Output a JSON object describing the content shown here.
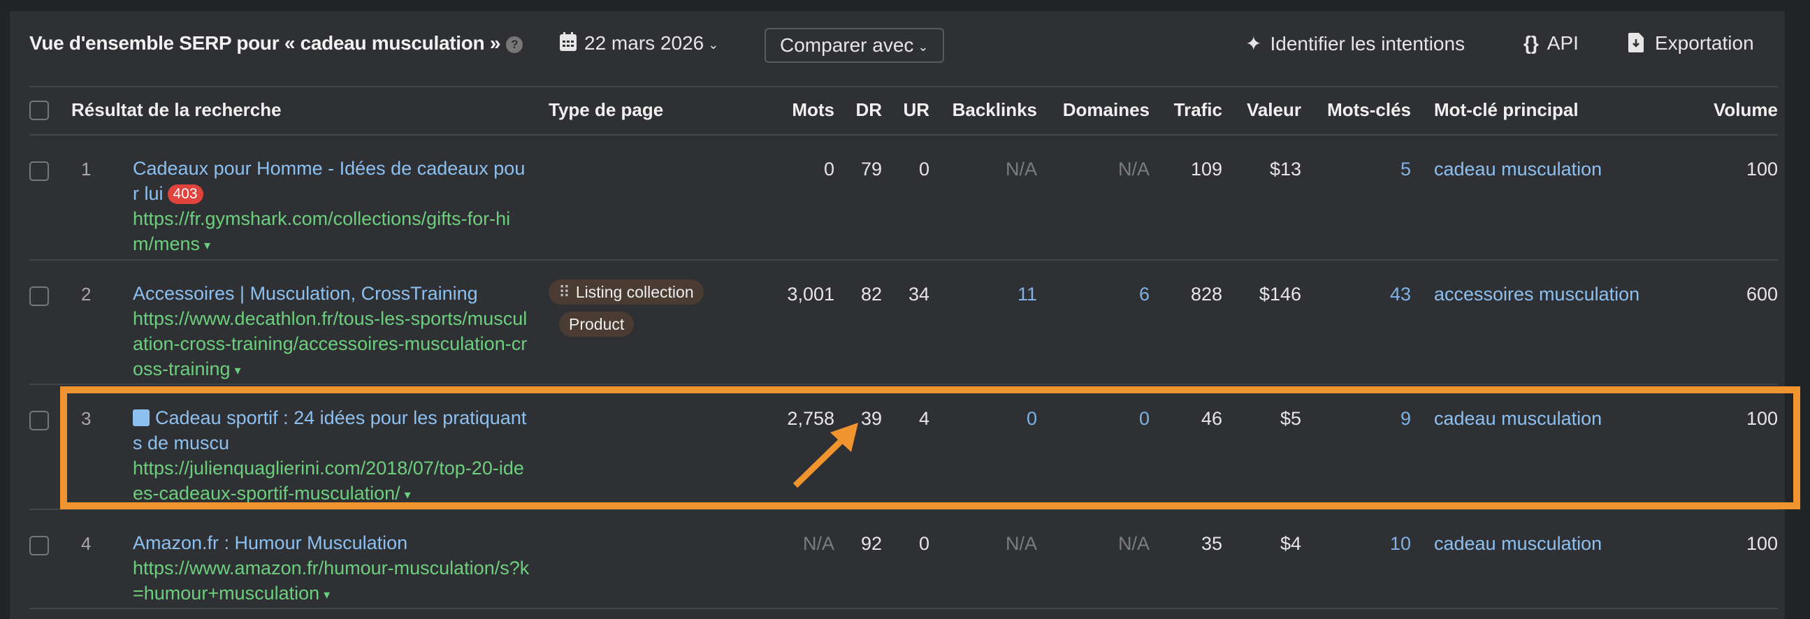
{
  "header": {
    "title": "Vue d'ensemble SERP pour « cadeau musculation »",
    "help_icon": "question-circle-icon",
    "date": "22 mars 2026",
    "compare_label": "Comparer avec",
    "tools": [
      {
        "label": "Identifier les intentions",
        "icon": "sparkles-icon"
      },
      {
        "label": "API",
        "icon": "braces-icon"
      },
      {
        "label": "Exportation",
        "icon": "download-file-icon"
      }
    ]
  },
  "columns": {
    "result": "Résultat de la recherche",
    "type": "Type de page",
    "mots": "Mots",
    "dr": "DR",
    "ur": "UR",
    "backlinks": "Backlinks",
    "domaines": "Domaines",
    "trafic": "Trafic",
    "valeur": "Valeur",
    "motscles": "Mots-clés",
    "principal": "Mot-clé principal",
    "volume": "Volume"
  },
  "rows": [
    {
      "pos": "1",
      "title": "Cadeaux pour Homme - Idées de cadeaux pour lui",
      "badge": "403",
      "url": "https://fr.gymshark.com/collections/gifts-for-him/mens",
      "types": [],
      "mots": "0",
      "dr": "79",
      "ur": "0",
      "backlinks": "N/A",
      "domaines": "N/A",
      "trafic": "109",
      "valeur": "$13",
      "motscles": "5",
      "principal": "cadeau musculation",
      "volume": "100"
    },
    {
      "pos": "2",
      "title": "Accessoires | Musculation, CrossTraining",
      "url": "https://www.decathlon.fr/tous-les-sports/musculation-cross-training/accessoires-musculation-cross-training",
      "types": [
        "Listing collection",
        "Product"
      ],
      "mots": "3,001",
      "dr": "82",
      "ur": "34",
      "backlinks": "11",
      "domaines": "6",
      "trafic": "828",
      "valeur": "$146",
      "motscles": "43",
      "principal": "accessoires musculation",
      "volume": "600"
    },
    {
      "pos": "3",
      "title": "Cadeau sportif : 24 idées pour les pratiquants de muscu",
      "url": "https://julienquaglierini.com/2018/07/top-20-idees-cadeaux-sportif-musculation/",
      "types": [],
      "mots": "2,758",
      "dr": "39",
      "ur": "4",
      "backlinks": "0",
      "domaines": "0",
      "trafic": "46",
      "valeur": "$5",
      "motscles": "9",
      "principal": "cadeau musculation",
      "volume": "100",
      "highlighted": true
    },
    {
      "pos": "4",
      "title": "Amazon.fr : Humour Musculation",
      "url": "https://www.amazon.fr/humour-musculation/s?k=humour+musculation",
      "types": [],
      "mots": "N/A",
      "dr": "92",
      "ur": "0",
      "backlinks": "N/A",
      "domaines": "N/A",
      "trafic": "35",
      "valeur": "$4",
      "motscles": "10",
      "principal": "cadeau musculation",
      "volume": "100"
    }
  ],
  "colors": {
    "highlight": "#f0942f",
    "link": "#8cc0f0",
    "url": "#6ccf7e",
    "error_badge": "#e0443c"
  }
}
